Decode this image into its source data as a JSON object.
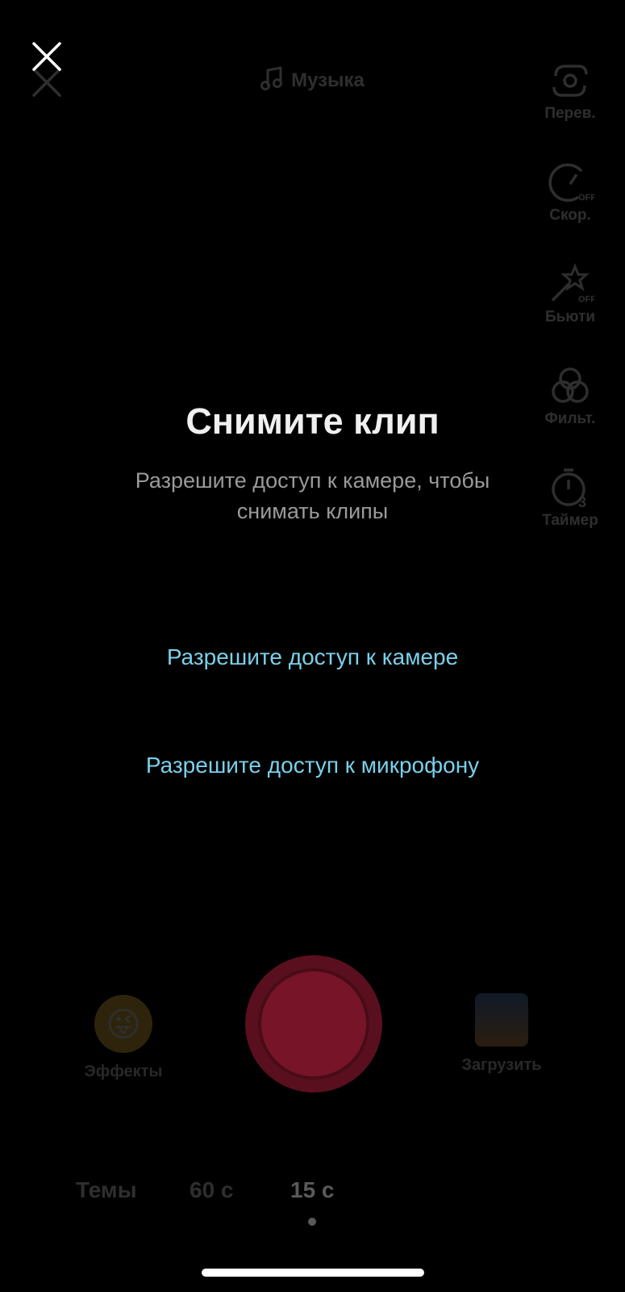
{
  "header": {
    "music_label": "Музыка"
  },
  "sidebar": {
    "items": [
      {
        "label": "Перев.",
        "icon": "flip-camera-icon"
      },
      {
        "label": "Скор.",
        "icon": "speed-icon"
      },
      {
        "label": "Бьюти",
        "icon": "beauty-icon"
      },
      {
        "label": "Фильт.",
        "icon": "filters-icon"
      },
      {
        "label": "Таймер",
        "icon": "timer-icon"
      }
    ]
  },
  "permission": {
    "title": "Снимите клип",
    "subtitle": "Разрешите доступ к камере, чтобы снимать клипы",
    "camera_link": "Разрешите доступ к камере",
    "mic_link": "Разрешите доступ к микрофону"
  },
  "bottom": {
    "effects_label": "Эффекты",
    "upload_label": "Загрузить",
    "modes": [
      "Темы",
      "60 с",
      "15 с"
    ],
    "selected_mode": "15 с"
  },
  "colors": {
    "link": "#7ad0ea",
    "record": "#fe2c55"
  }
}
